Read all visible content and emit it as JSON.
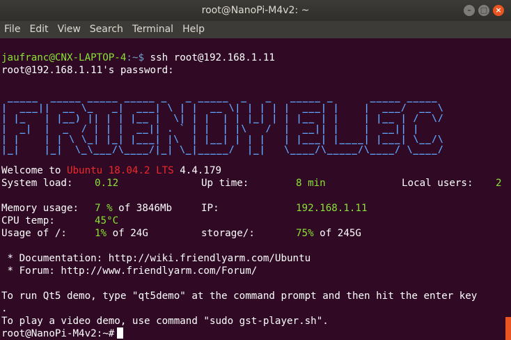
{
  "window": {
    "title": "root@NanoPi-M4v2: ~",
    "controls": [
      "minimize",
      "maximize",
      "close"
    ]
  },
  "menu": [
    "File",
    "Edit",
    "View",
    "Search",
    "Terminal",
    "Help"
  ],
  "terminal": {
    "prompt_user": "jaufranc@CNX-LAPTOP-4",
    "prompt_path": ":~$",
    "command": " ssh root@192.168.1.11",
    "password_prompt": "root@192.168.1.11's password:",
    "banner": "FriendlyELEC",
    "welcome": "Welcome to",
    "os": "Ubuntu 18.04.2 LTS",
    "kernel": " 4.4.179",
    "system_load_label": "System load:",
    "system_load": "0.12",
    "uptime_label": "Up time:",
    "uptime": "8 min",
    "local_users_label": "Local users:",
    "local_users": "2",
    "memory_label": "Memory usage:",
    "memory_pct": "7 %",
    "memory_total": " of 3846Mb",
    "ip_label": "IP:",
    "ip": "192.168.1.11",
    "cpu_temp_label": "CPU temp:",
    "cpu_temp": "45°C",
    "usage_label": "Usage of /:",
    "usage_pct": "1%",
    "usage_total": " of 24G",
    "storage_label": "storage/:",
    "storage_pct": "75%",
    "storage_total": " of 245G",
    "doc_line": " * Documentation: http://wiki.friendlyarm.com/Ubuntu",
    "forum_line": " * Forum: http://www.friendlyarm.com/Forum/",
    "qt5_line": "To run Qt5 demo, type \"qt5demo\" at the command prompt and then hit the enter key",
    "qt5_cont": ".",
    "video_line": "To play a video demo, use command \"sudo gst-player.sh\".",
    "final_prompt": "root@NanoPi-M4v2:~#"
  },
  "colors": {
    "background": "#300a24",
    "prompt_green": "#8ae234",
    "ubuntu_red": "#ef2929",
    "accent_orange": "#e95420"
  }
}
